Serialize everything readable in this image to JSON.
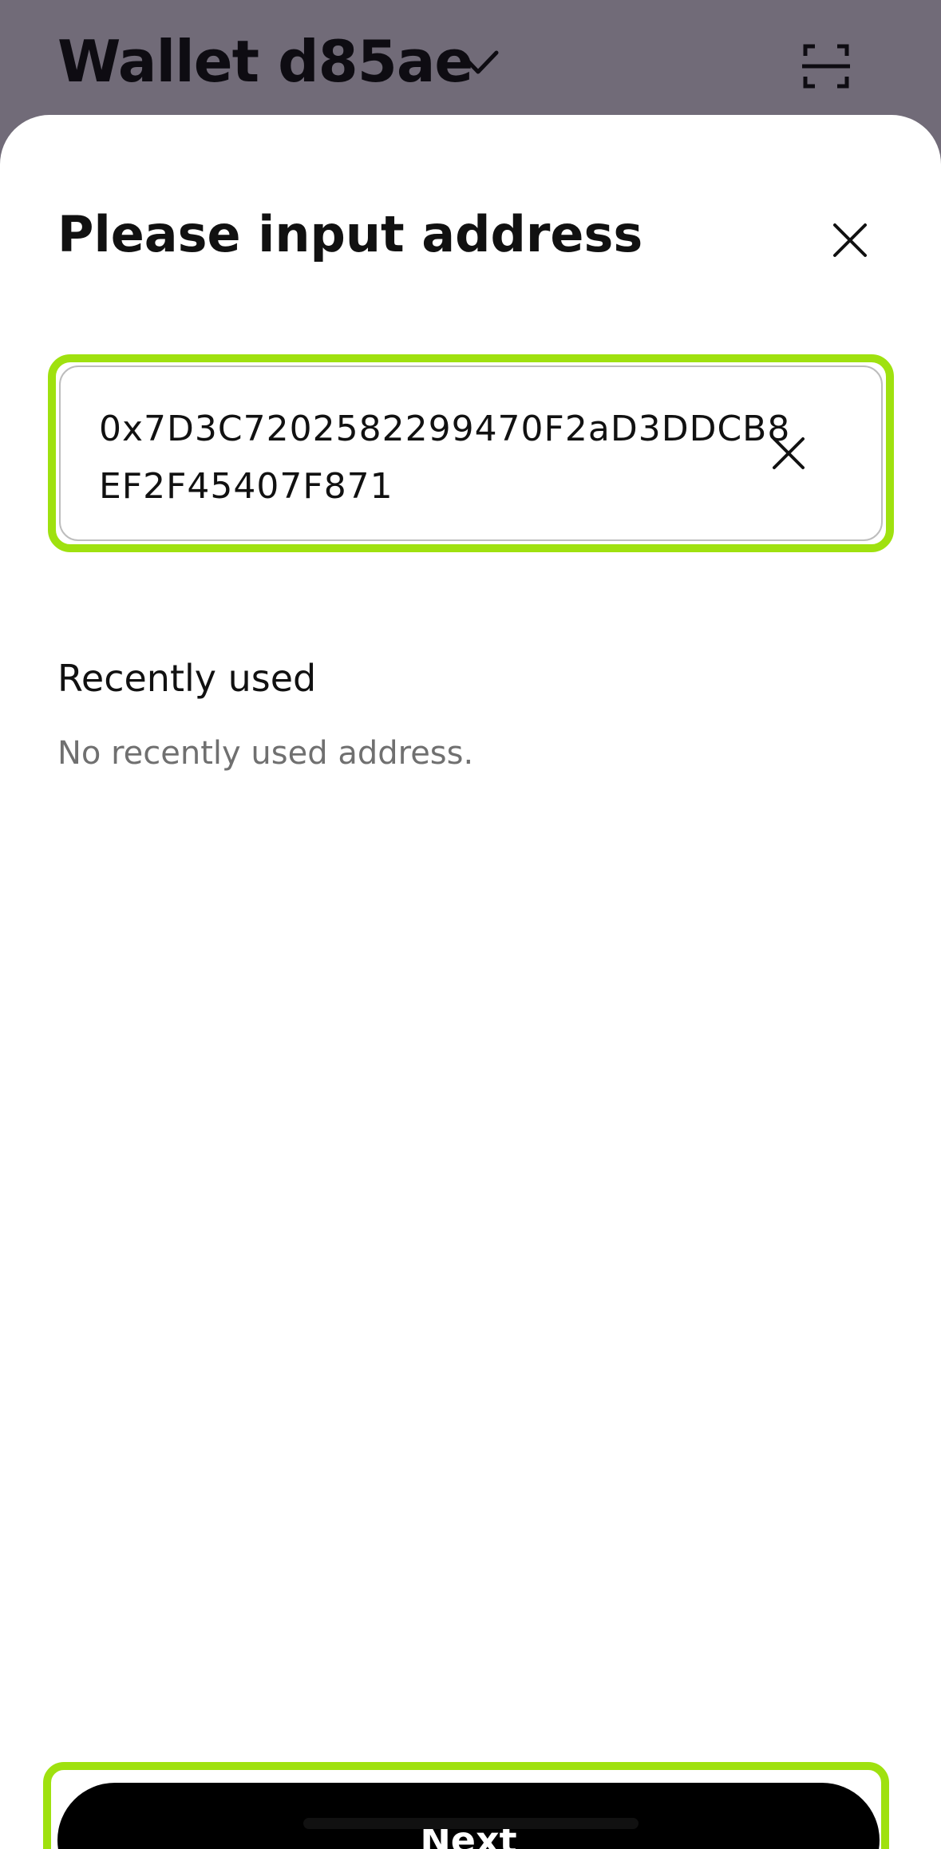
{
  "header": {
    "wallet_title": "Wallet d85ae",
    "chevron_icon": "chevron-down-icon",
    "scan_icon": "scan-icon"
  },
  "sheet": {
    "title": "Please input address",
    "close_icon": "close-icon"
  },
  "address_input": {
    "value": "0x7D3C7202582299470F2aD3DDCB8EF2F45407F871",
    "clear_icon": "clear-icon"
  },
  "recent": {
    "title": "Recently used",
    "empty_text": "No recently used address."
  },
  "actions": {
    "next_label": "Next"
  },
  "colors": {
    "highlight": "#9fe10f",
    "overlay": "#716b78",
    "primary_button": "#000000"
  }
}
